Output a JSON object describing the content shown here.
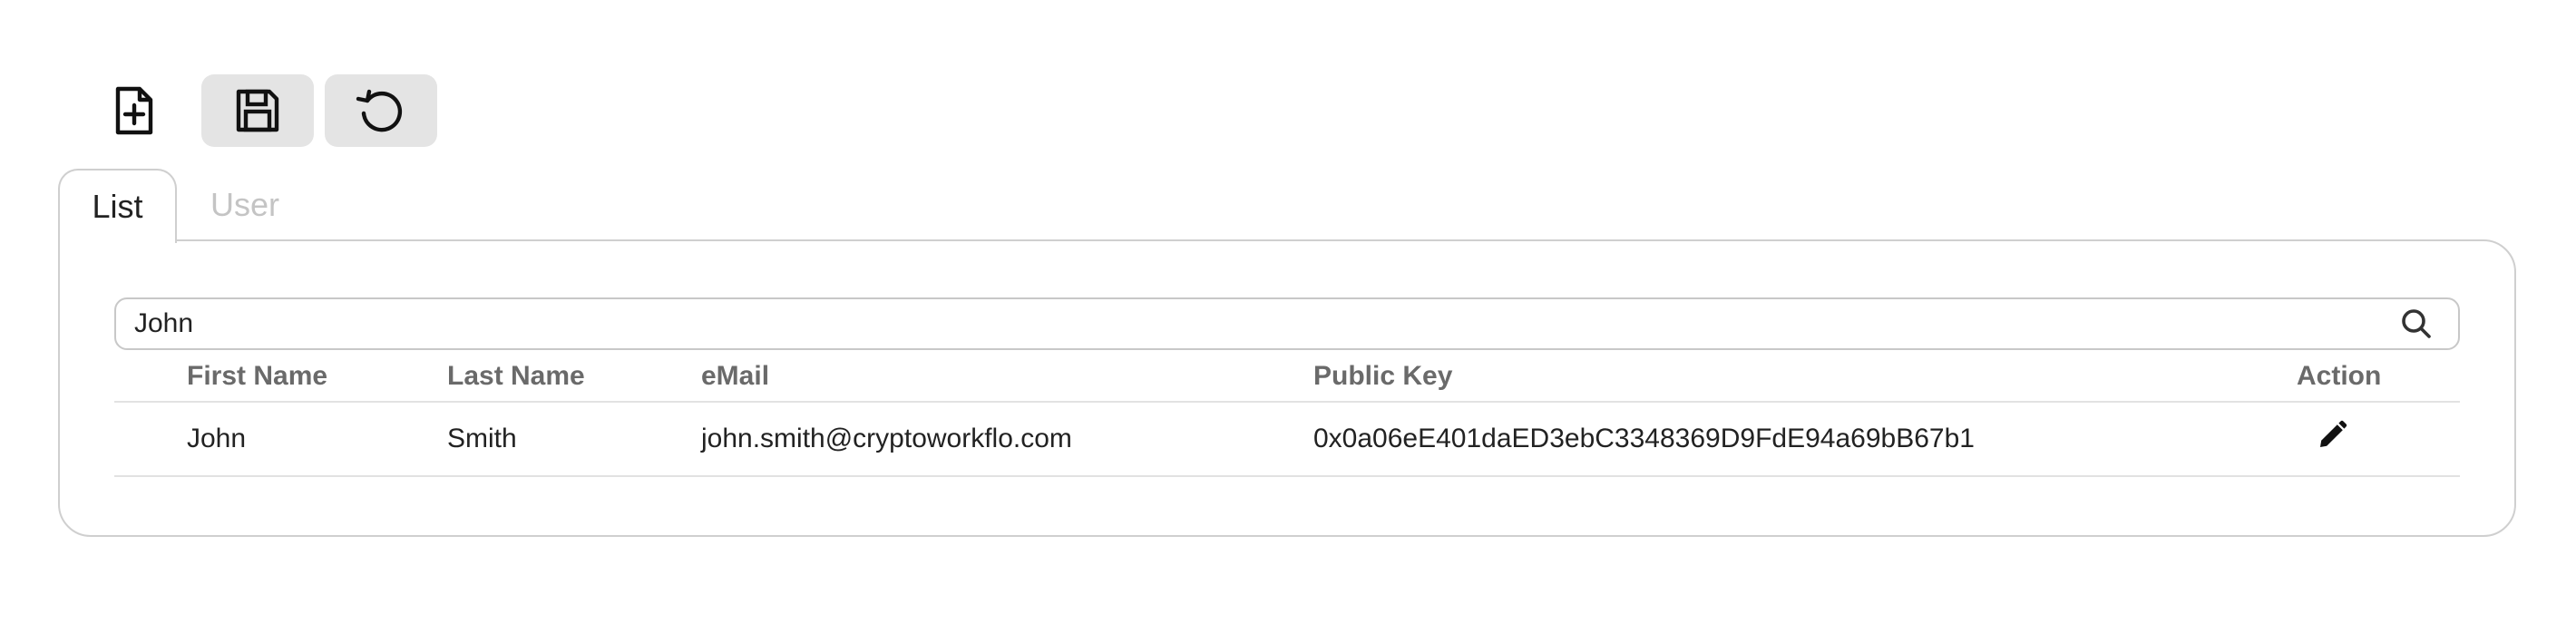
{
  "toolbar": {
    "buttons": [
      {
        "icon": "new-document-icon"
      },
      {
        "icon": "save-icon"
      },
      {
        "icon": "refresh-icon"
      }
    ]
  },
  "tabs": [
    {
      "label": "List",
      "active": true
    },
    {
      "label": "User",
      "active": false
    }
  ],
  "search": {
    "value": "John",
    "icon": "search-icon"
  },
  "table": {
    "columns": [
      "First Name",
      "Last Name",
      "eMail",
      "Public Key",
      "Action"
    ],
    "rows": [
      {
        "first_name": "John",
        "last_name": "Smith",
        "email": "john.smith@cryptoworkflo.com",
        "public_key": "0x0a06eE401daED3ebC3348369D9FdE94a69bB67b1",
        "action_icon": "edit-pencil-icon"
      }
    ]
  },
  "colors": {
    "button_bg": "#e4e4e4",
    "border": "#cfcfcf",
    "header_text": "#6a6a6a",
    "inactive_tab": "#c4c4c4"
  }
}
